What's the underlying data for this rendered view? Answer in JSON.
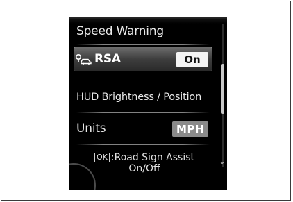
{
  "menu": {
    "items": [
      {
        "label": "Speed Warning"
      },
      {
        "label": "RSA",
        "value": "On",
        "icon": "road-sign-car-icon"
      },
      {
        "label": "HUD Brightness / Position"
      },
      {
        "label": "Units",
        "value": "MPH"
      }
    ],
    "selected_index": 1
  },
  "hint": {
    "key": "OK",
    "text": ":Road Sign Assist On/Off"
  },
  "scroll": {
    "down_icon": "chevron-down-icon"
  },
  "colors": {
    "screen_bg": "#000000",
    "text": "#e9e9e9",
    "on_badge": "#f4f4f4",
    "mph_badge": "#8a8a8a"
  }
}
